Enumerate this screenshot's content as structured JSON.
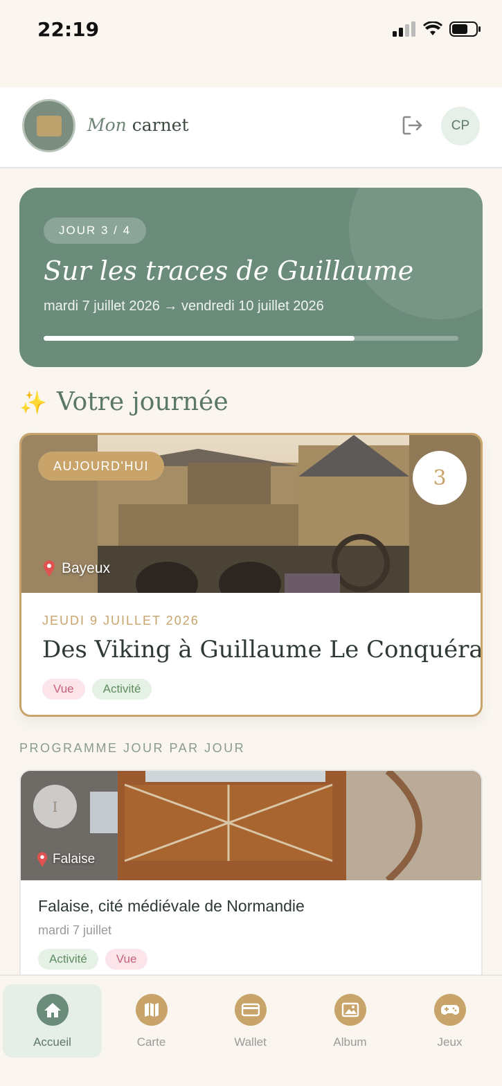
{
  "status_bar": {
    "time": "22:19"
  },
  "header": {
    "title_italic": "Mon",
    "title_rest": "carnet",
    "avatar_initials": "CP"
  },
  "trip": {
    "day_badge": "JOUR 3 / 4",
    "title": "Sur les traces de Guillaume",
    "dates": "mardi 7 juillet 2026 → vendredi 10 juillet 2026",
    "progress": 0.75
  },
  "section": {
    "sparkle": "✨",
    "title": "Votre journée"
  },
  "today": {
    "badge": "AUJOURD'HUI",
    "day_number": "3",
    "location": "Bayeux",
    "date": "JEUDI 9 JUILLET 2026",
    "title": "Des Viking à Guillaume Le Conquérant",
    "tags": [
      "Vue",
      "Activité"
    ]
  },
  "program": {
    "label": "PROGRAMME JOUR PAR JOUR",
    "days": [
      {
        "number": "I",
        "location": "Falaise",
        "title": "Falaise, cité médiévale de Normandie",
        "date": "mardi 7 juillet",
        "tags": [
          "Activité",
          "Vue"
        ]
      }
    ]
  },
  "tabbar": {
    "tabs": [
      {
        "label": "Accueil",
        "icon": "home-icon"
      },
      {
        "label": "Carte",
        "icon": "map-icon"
      },
      {
        "label": "Wallet",
        "icon": "wallet-icon"
      },
      {
        "label": "Album",
        "icon": "album-icon"
      },
      {
        "label": "Jeux",
        "icon": "gamepad-icon"
      }
    ]
  },
  "colors": {
    "accent_green": "#6b8c7b",
    "accent_gold": "#c9a46a",
    "tag_pink": "#fbe4ea",
    "tag_green": "#e6f1e6"
  }
}
